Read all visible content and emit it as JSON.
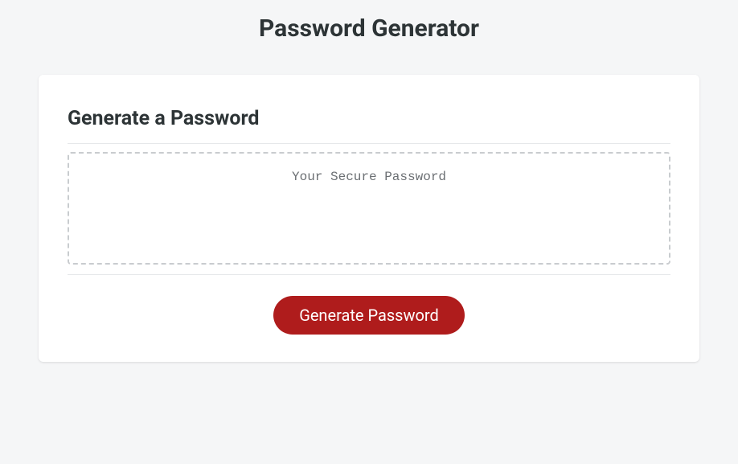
{
  "header": {
    "page_title": "Password Generator"
  },
  "card": {
    "title": "Generate a Password",
    "password_placeholder": "Your Secure Password",
    "generate_button_label": "Generate Password"
  }
}
